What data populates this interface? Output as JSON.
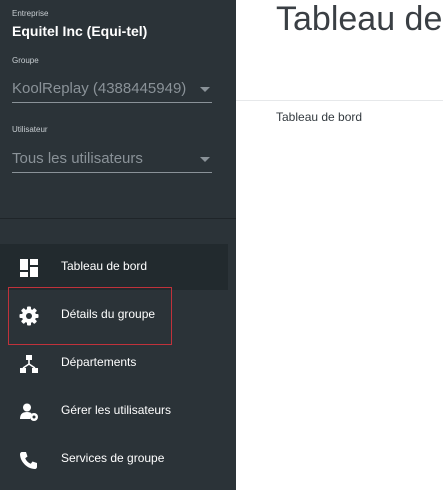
{
  "sidebar": {
    "company_label": "Entreprise",
    "company_name": "Equitel Inc (Equi-tel)",
    "group_label": "Groupe",
    "group_value": "KoolReplay (4388445949)",
    "user_label": "Utilisateur",
    "user_value": "Tous les utilisateurs",
    "nav": [
      {
        "label": "Tableau de bord",
        "icon": "dashboard-icon",
        "active": true
      },
      {
        "label": "Détails du groupe",
        "icon": "gear-icon",
        "highlighted": true
      },
      {
        "label": "Départements",
        "icon": "org-chart-icon"
      },
      {
        "label": "Gérer les utilisateurs",
        "icon": "user-settings-icon"
      },
      {
        "label": "Services de groupe",
        "icon": "phone-icon"
      }
    ]
  },
  "main": {
    "title": "Tableau de bord",
    "breadcrumb": "Tableau de bord"
  },
  "colors": {
    "sidebar_bg": "#2b3338",
    "highlight_border": "#c0323b"
  }
}
